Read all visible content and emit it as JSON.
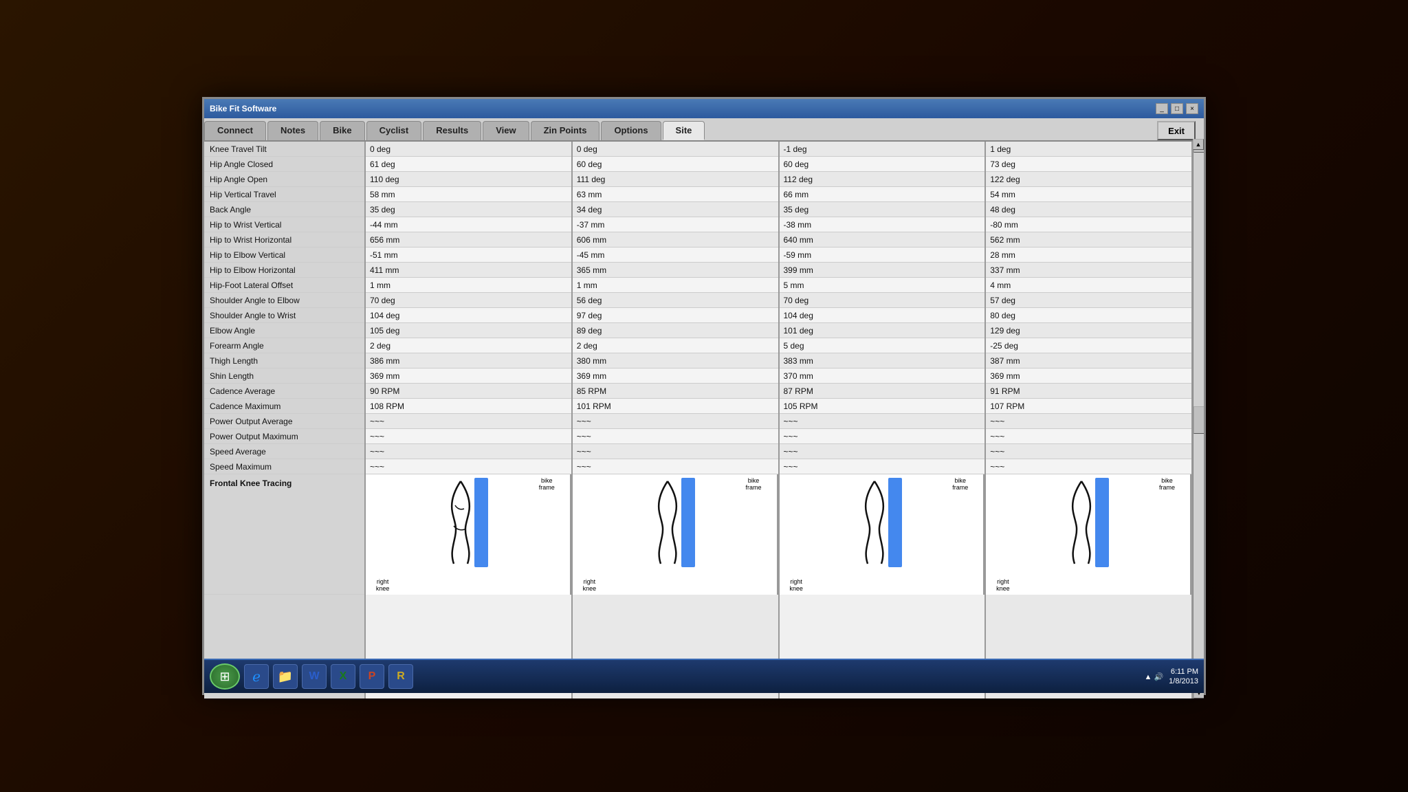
{
  "window": {
    "title": "Bike Fit Software",
    "exit_label": "Exit"
  },
  "tabs": [
    {
      "label": "Connect",
      "active": false
    },
    {
      "label": "Notes",
      "active": false
    },
    {
      "label": "Bike",
      "active": false
    },
    {
      "label": "Cyclist",
      "active": false
    },
    {
      "label": "Results",
      "active": false
    },
    {
      "label": "View",
      "active": false
    },
    {
      "label": "Zin Points",
      "active": false
    },
    {
      "label": "Options",
      "active": false
    },
    {
      "label": "Site",
      "active": true
    }
  ],
  "row_labels": [
    "Knee Travel Tilt",
    "Hip Angle Closed",
    "Hip Angle Open",
    "Hip Vertical Travel",
    "Back Angle",
    "Hip to Wrist Vertical",
    "Hip to Wrist Horizontal",
    "Hip to Elbow Vertical",
    "Hip to Elbow Horizontal",
    "Hip-Foot Lateral Offset",
    "Shoulder Angle to Elbow",
    "Shoulder Angle to Wrist",
    "Elbow Angle",
    "Forearm Angle",
    "Thigh Length",
    "Shin Length",
    "Cadence Average",
    "Cadence Maximum",
    "Power Output Average",
    "Power Output Maximum",
    "Speed Average",
    "Speed Maximum",
    "Frontal Knee Tracing"
  ],
  "columns": [
    {
      "id": "col1",
      "cells": [
        "0 deg",
        "61 deg",
        "110 deg",
        "58 mm",
        "35 deg",
        "-44 mm",
        "656 mm",
        "-51 mm",
        "411 mm",
        "1 mm",
        "70 deg",
        "104 deg",
        "105 deg",
        "2 deg",
        "386 mm",
        "369 mm",
        "90 RPM",
        "108 RPM",
        "~~~",
        "~~~",
        "~~~",
        "~~~"
      ]
    },
    {
      "id": "col2",
      "cells": [
        "0 deg",
        "60 deg",
        "111 deg",
        "63 mm",
        "34 deg",
        "-37 mm",
        "606 mm",
        "-45 mm",
        "365 mm",
        "1 mm",
        "56 deg",
        "97 deg",
        "89 deg",
        "2 deg",
        "380 mm",
        "369 mm",
        "85 RPM",
        "101 RPM",
        "~~~",
        "~~~",
        "~~~",
        "~~~"
      ]
    },
    {
      "id": "col3",
      "cells": [
        "-1 deg",
        "60 deg",
        "112 deg",
        "66 mm",
        "35 deg",
        "-38 mm",
        "640 mm",
        "-59 mm",
        "399 mm",
        "5 mm",
        "70 deg",
        "104 deg",
        "101 deg",
        "5 deg",
        "383 mm",
        "370 mm",
        "87 RPM",
        "105 RPM",
        "~~~",
        "~~~",
        "~~~",
        "~~~"
      ]
    },
    {
      "id": "col4",
      "cells": [
        "1 deg",
        "73 deg",
        "122 deg",
        "54 mm",
        "48 deg",
        "-80 mm",
        "562 mm",
        "28 mm",
        "337 mm",
        "4 mm",
        "57 deg",
        "80 deg",
        "129 deg",
        "-25 deg",
        "387 mm",
        "369 mm",
        "91 RPM",
        "107 RPM",
        "~~~",
        "~~~",
        "~~~",
        "~~~"
      ]
    }
  ],
  "knee_diagrams": [
    {
      "right_knee": "right\nknee",
      "bike_frame": "bike\nframe"
    },
    {
      "right_knee": "right\nknee",
      "bike_frame": "bike\nframe"
    },
    {
      "right_knee": "right\nknee",
      "bike_frame": "bike\nframe"
    },
    {
      "right_knee": "right\nknee",
      "bike_frame": "bike\nframe"
    }
  ],
  "taskbar": {
    "clock_time": "6:11 PM",
    "clock_date": "1/8/2013"
  },
  "scrollbar": {
    "up_arrow": "▲",
    "down_arrow": "▼"
  }
}
